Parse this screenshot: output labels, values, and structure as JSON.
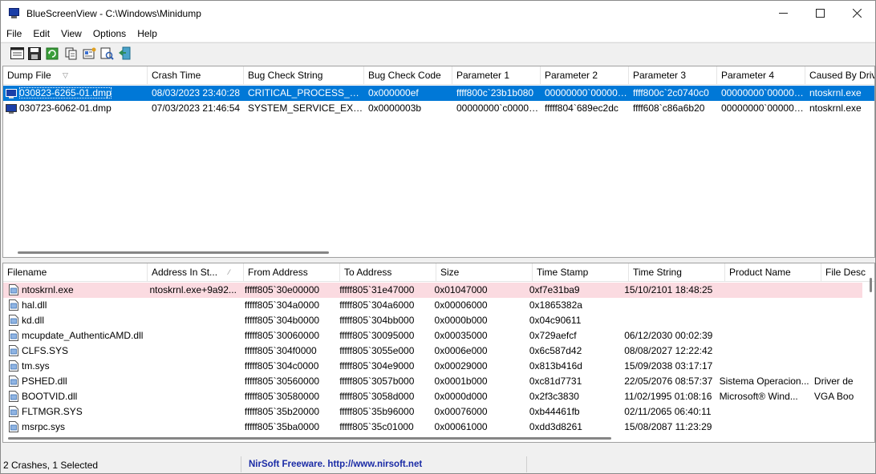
{
  "window": {
    "title": "BlueScreenView  -  C:\\Windows\\Minidump"
  },
  "menu": [
    "File",
    "Edit",
    "View",
    "Options",
    "Help"
  ],
  "toolbar": {
    "icons": [
      "properties-window-icon",
      "save-icon",
      "refresh-icon",
      "copy-icon",
      "report-icon",
      "advanced-options-icon",
      "exit-icon"
    ]
  },
  "top_list": {
    "columns": [
      "Dump File",
      "Crash Time",
      "Bug Check String",
      "Bug Check Code",
      "Parameter 1",
      "Parameter 2",
      "Parameter 3",
      "Parameter 4",
      "Caused By Drive"
    ],
    "rows": [
      [
        "030823-6265-01.dmp",
        "08/03/2023 23:40:28",
        "CRITICAL_PROCESS_DIED",
        "0x000000ef",
        "ffff800c`23b1b080",
        "00000000`000000...",
        "ffff800c`2c0740c0",
        "00000000`000000...",
        "ntoskrnl.exe"
      ],
      [
        "030723-6062-01.dmp",
        "07/03/2023 21:46:54",
        "SYSTEM_SERVICE_EXCEP...",
        "0x0000003b",
        "00000000`c00000...",
        "fffff804`689ec2dc",
        "ffff608`c86a6b20",
        "00000000`000000...",
        "ntoskrnl.exe"
      ]
    ],
    "selected_row": 0
  },
  "bottom_list": {
    "columns": [
      "Filename",
      "Address In St...",
      "From Address",
      "To Address",
      "Size",
      "Time Stamp",
      "Time String",
      "Product Name",
      "File Desc"
    ],
    "rows": [
      [
        "ntoskrnl.exe",
        "ntoskrnl.exe+9a92...",
        "fffff805`30e00000",
        "fffff805`31e47000",
        "0x01047000",
        "0xf7e31ba9",
        "15/10/2101 18:48:25",
        "",
        ""
      ],
      [
        "hal.dll",
        "",
        "fffff805`304a0000",
        "fffff805`304a6000",
        "0x00006000",
        "0x1865382a",
        "",
        "",
        ""
      ],
      [
        "kd.dll",
        "",
        "fffff805`304b0000",
        "fffff805`304bb000",
        "0x0000b000",
        "0x04c90611",
        "",
        "",
        ""
      ],
      [
        "mcupdate_AuthenticAMD.dll",
        "",
        "fffff805`30060000",
        "fffff805`30095000",
        "0x00035000",
        "0x729aefcf",
        "06/12/2030 00:02:39",
        "",
        ""
      ],
      [
        "CLFS.SYS",
        "",
        "fffff805`304f0000",
        "fffff805`3055e000",
        "0x0006e000",
        "0x6c587d42",
        "08/08/2027 12:22:42",
        "",
        ""
      ],
      [
        "tm.sys",
        "",
        "fffff805`304c0000",
        "fffff805`304e9000",
        "0x00029000",
        "0x813b416d",
        "15/09/2038 03:17:17",
        "",
        ""
      ],
      [
        "PSHED.dll",
        "",
        "fffff805`30560000",
        "fffff805`3057b000",
        "0x0001b000",
        "0xc81d7731",
        "22/05/2076 08:57:37",
        "Sistema Operacion...",
        "Driver de"
      ],
      [
        "BOOTVID.dll",
        "",
        "fffff805`30580000",
        "fffff805`3058d000",
        "0x0000d000",
        "0x2f3c3830",
        "11/02/1995 01:08:16",
        "Microsoft® Wind...",
        "VGA Boo"
      ],
      [
        "FLTMGR.SYS",
        "",
        "fffff805`35b20000",
        "fffff805`35b96000",
        "0x00076000",
        "0xb44461fb",
        "02/11/2065 06:40:11",
        "",
        ""
      ],
      [
        "msrpc.sys",
        "",
        "fffff805`35ba0000",
        "fffff805`35c01000",
        "0x00061000",
        "0xdd3d8261",
        "15/08/2087 11:23:29",
        "",
        ""
      ]
    ],
    "highlighted_row": 0
  },
  "status": {
    "summary": "2 Crashes, 1 Selected",
    "link": "NirSoft Freeware.  http://www.nirsoft.net"
  },
  "colors": {
    "selection": "#0078d7",
    "highlight_row": "#fbdbe1",
    "link": "#1a2ba6"
  }
}
